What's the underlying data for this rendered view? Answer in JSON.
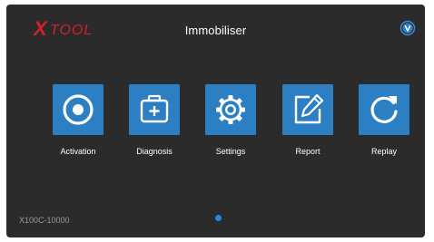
{
  "brand": {
    "logo_text": "XTOOL",
    "logo_color": "#d4202a"
  },
  "header": {
    "title": "Immobiliser",
    "right_icon": "v-circle-icon"
  },
  "apps": [
    {
      "label": "Activation",
      "icon": "target-circle-icon"
    },
    {
      "label": "Diagnosis",
      "icon": "medical-kit-icon"
    },
    {
      "label": "Settings",
      "icon": "gear-icon"
    },
    {
      "label": "Report",
      "icon": "edit-document-icon"
    },
    {
      "label": "Replay",
      "icon": "replay-arrow-icon"
    }
  ],
  "footer": {
    "model": "X100C-10000"
  },
  "pagination": {
    "current_page": 1,
    "total_pages": 1
  },
  "colors": {
    "background": "#2b2b2b",
    "tile": "#2d7fc3",
    "accent": "#1e88e5"
  }
}
